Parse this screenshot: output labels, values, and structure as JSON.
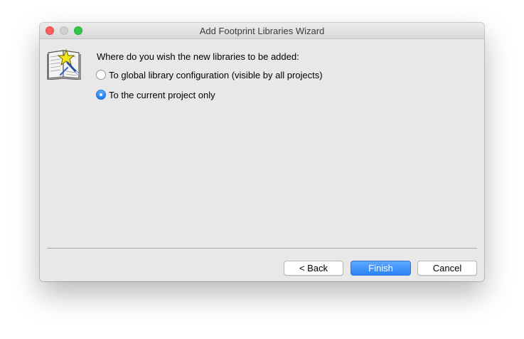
{
  "window": {
    "title": "Add Footprint Libraries Wizard"
  },
  "icons": {
    "close": "close-icon",
    "minimize": "minimize-icon",
    "maximize": "maximize-icon",
    "wizard": "wizard-book-icon"
  },
  "question": "Where do you wish the new libraries to be added:",
  "options": [
    {
      "label": "To global library configuration (visible by all projects)",
      "selected": false
    },
    {
      "label": "To the current project only",
      "selected": true
    }
  ],
  "buttons": {
    "back": "< Back",
    "finish": "Finish",
    "cancel": "Cancel"
  },
  "colors": {
    "accent": "#2b82f4",
    "close": "#fc615d",
    "maximize": "#34c84a"
  }
}
